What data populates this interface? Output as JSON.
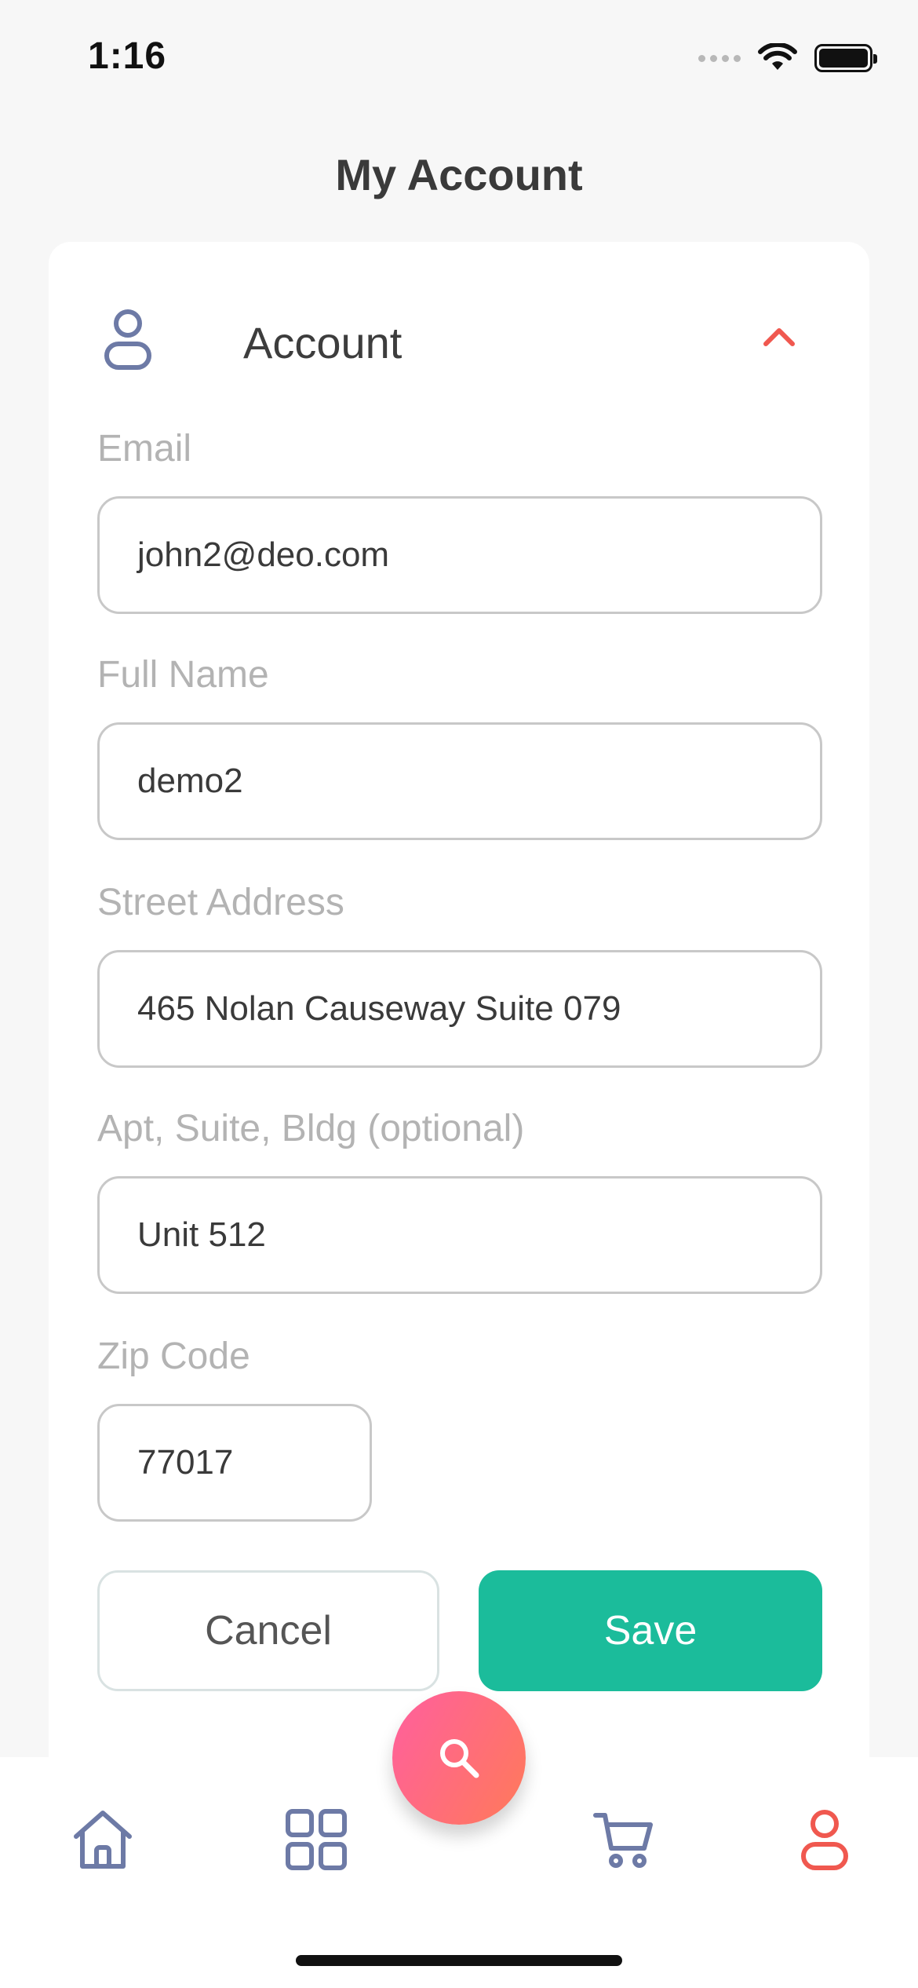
{
  "status": {
    "time": "1:16"
  },
  "page": {
    "title": "My Account"
  },
  "account": {
    "section_title": "Account",
    "fields": {
      "email": {
        "label": "Email",
        "value": "john2@deo.com"
      },
      "full_name": {
        "label": "Full Name",
        "value": "demo2"
      },
      "street": {
        "label": "Street Address",
        "value": "465 Nolan Causeway Suite 079"
      },
      "apt": {
        "label": "Apt, Suite, Bldg (optional)",
        "value": "Unit 512"
      },
      "zip": {
        "label": "Zip Code",
        "value": "77017"
      }
    },
    "cancel_label": "Cancel",
    "save_label": "Save"
  },
  "tabs": [
    {
      "icon": "home-icon"
    },
    {
      "icon": "grid-icon"
    },
    {
      "icon": "search-icon"
    },
    {
      "icon": "cart-icon"
    },
    {
      "icon": "user-icon",
      "active": true
    }
  ],
  "colors": {
    "accent": "#1bbc9b",
    "active_tab": "#f0584f",
    "inactive_icon": "#6d7aa6",
    "fab_gradient_start": "#ff5f9e",
    "fab_gradient_end": "#ff7a59"
  }
}
